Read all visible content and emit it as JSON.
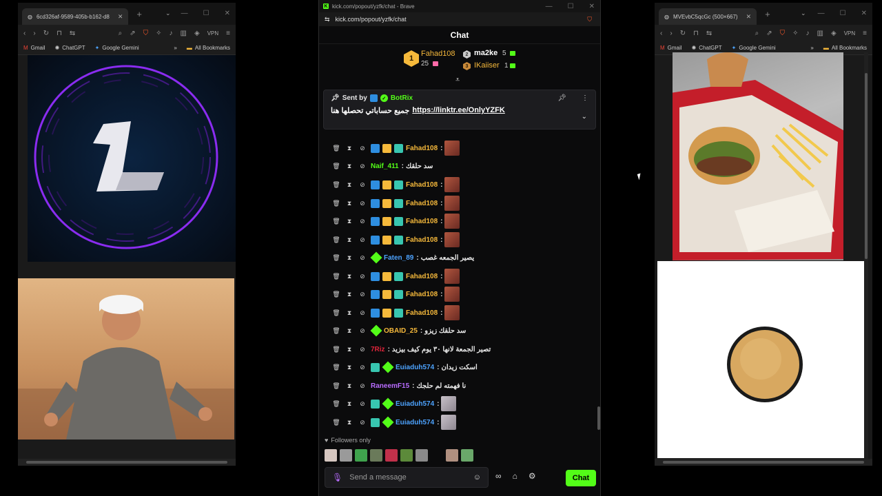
{
  "left_window": {
    "tab_title": "6cd326af-9589-405b-b162-d8",
    "vpn_label": "VPN",
    "bookmarks": [
      "Gmail",
      "ChatGPT",
      "Google Gemini"
    ],
    "all_bookmarks": "All Bookmarks"
  },
  "center_window": {
    "title_bar": "kick.com/popout/yzfk/chat - Brave",
    "url": "kick.com/popout/yzfk/chat",
    "chat_heading": "Chat",
    "leaderboard": [
      {
        "rank": "1",
        "name": "Fahad108",
        "count": "25",
        "gift_color": "#ff6aa8"
      },
      {
        "rank": "2",
        "name": "ma2ke",
        "count": "5",
        "gift_color": "#53fc18"
      },
      {
        "rank": "3",
        "name": "IKaiiser",
        "count": "1",
        "gift_color": "#53fc18"
      }
    ],
    "pinned": {
      "sent_by": "Sent by",
      "user": "BotRix",
      "message_arabic": "جميع حساباتي تحصلها هنا",
      "message_link": "https://linktr.ee/OnlyYZFK"
    },
    "messages": [
      {
        "user": "Fahad108",
        "color": "#f6b93b",
        "text": "",
        "badges": [
          "blue",
          "gold",
          "teal"
        ],
        "emote": "red"
      },
      {
        "user": "Naif_411",
        "color": "#53fc18",
        "text": "سد حلقك",
        "badges": [],
        "emote": ""
      },
      {
        "user": "Fahad108",
        "color": "#f6b93b",
        "text": "",
        "badges": [
          "blue",
          "gold",
          "teal"
        ],
        "emote": "red"
      },
      {
        "user": "Fahad108",
        "color": "#f6b93b",
        "text": "",
        "badges": [
          "blue",
          "gold",
          "teal"
        ],
        "emote": "red"
      },
      {
        "user": "Fahad108",
        "color": "#f6b93b",
        "text": "",
        "badges": [
          "blue",
          "gold",
          "teal"
        ],
        "emote": "red"
      },
      {
        "user": "Fahad108",
        "color": "#f6b93b",
        "text": "",
        "badges": [
          "blue",
          "gold",
          "teal"
        ],
        "emote": "red"
      },
      {
        "user": "Faten_89",
        "color": "#4da3ff",
        "text": "يصير الجمعه غصب",
        "badges": [
          "green"
        ],
        "emote": ""
      },
      {
        "user": "Fahad108",
        "color": "#f6b93b",
        "text": "",
        "badges": [
          "blue",
          "gold",
          "teal"
        ],
        "emote": "red"
      },
      {
        "user": "Fahad108",
        "color": "#f6b93b",
        "text": "",
        "badges": [
          "blue",
          "gold",
          "teal"
        ],
        "emote": "red"
      },
      {
        "user": "Fahad108",
        "color": "#f6b93b",
        "text": "",
        "badges": [
          "blue",
          "gold",
          "teal"
        ],
        "emote": "red"
      },
      {
        "user": "OBAID_25",
        "color": "#f6b93b",
        "text": "سد حلقك زيزو",
        "badges": [
          "green"
        ],
        "emote": ""
      },
      {
        "user": "7Riz",
        "color": "#e0243a",
        "text": "تصير الجمعة لانها ٣٠ يوم كيف بيزيد",
        "badges": [],
        "emote": ""
      },
      {
        "user": "Euiaduh574",
        "color": "#4da3ff",
        "text": "اسكت زيدان",
        "badges": [
          "teal",
          "green"
        ],
        "emote": ""
      },
      {
        "user": "RaneemF15",
        "color": "#b86cff",
        "text": "نا فهمته لم حلجك",
        "badges": [],
        "emote": ""
      },
      {
        "user": "Euiaduh574",
        "color": "#4da3ff",
        "text": "",
        "badges": [
          "teal",
          "green"
        ],
        "emote": "grey"
      },
      {
        "user": "Euiaduh574",
        "color": "#4da3ff",
        "text": "",
        "badges": [
          "teal",
          "green"
        ],
        "emote": "grey"
      }
    ],
    "followers_only": "Followers only",
    "composer_placeholder": "Send a message",
    "chat_button": "Chat"
  },
  "right_window": {
    "tab_title": "MVEvbC5qcGc (500×667)",
    "vpn_label": "VPN",
    "bookmarks": [
      "Gmail",
      "ChatGPT",
      "Google Gemini"
    ],
    "all_bookmarks": "All Bookmarks"
  }
}
